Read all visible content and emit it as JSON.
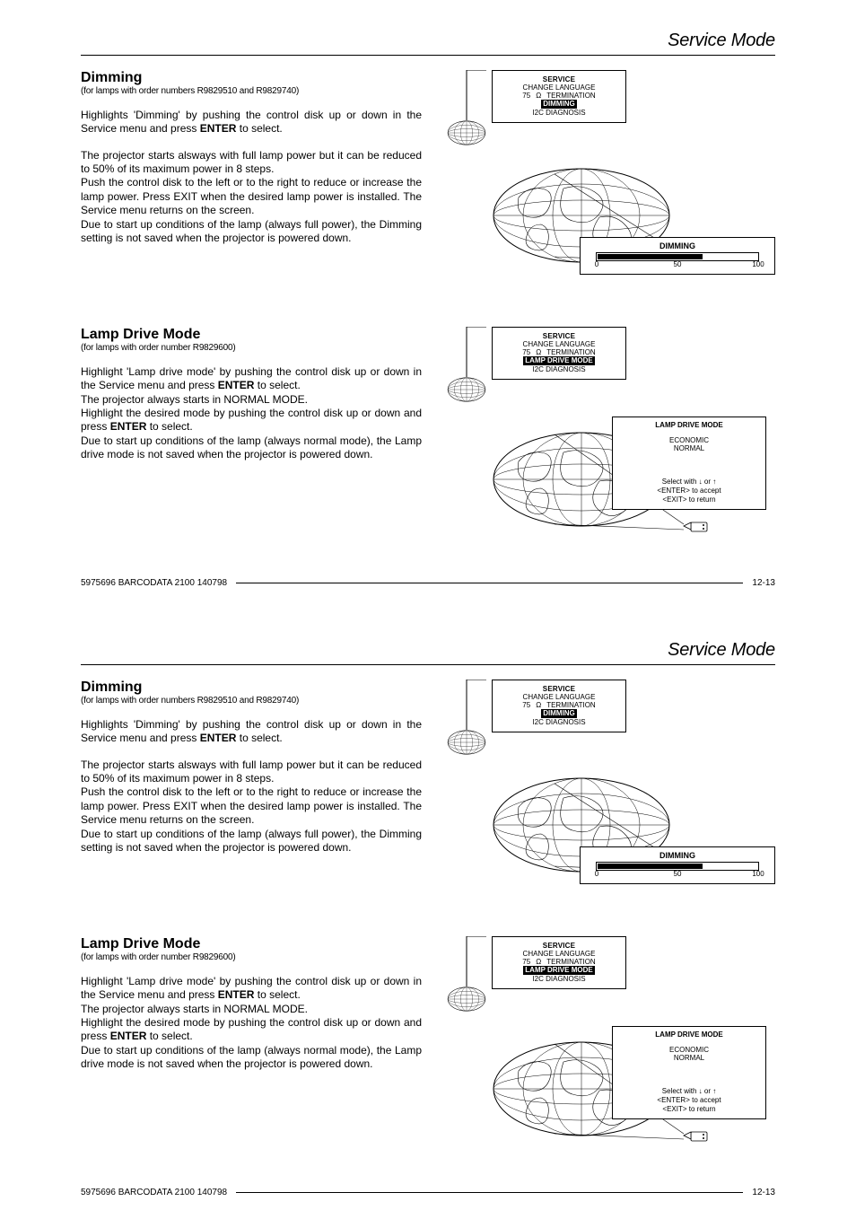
{
  "header": "Service Mode",
  "dimming": {
    "title": "Dimming",
    "sub": "(for lamps with order numbers R9829510 and R9829740)",
    "p1a": "Highlights 'Dimming' by pushing the control disk up or down in the Service menu and press ",
    "enter": "ENTER",
    "p1b": " to select.",
    "p2": "The projector starts alsways with full lamp power but it can be reduced to 50% of its maximum power in 8 steps.",
    "p3": "Push the control disk to the left or to the right to reduce or increase the lamp power.  Press EXIT when the desired lamp power is installed. The Service menu returns on the screen.",
    "p4": "Due to start up conditions of the lamp (always full power), the Dimming setting is not saved when the projector is powered down."
  },
  "ldm": {
    "title": "Lamp Drive Mode",
    "sub": "(for lamps with order number R9829600)",
    "p1a": "Highlight 'Lamp drive mode' by pushing the control disk up or down in the Service menu and press ",
    "p1b": " to select.",
    "p2": "The projector always starts in NORMAL MODE.",
    "p3a": "Highlight the desired mode by pushing the control disk up or down and press ",
    "p3b": " to select.",
    "p4": "Due to start up conditions of the lamp (always normal mode), the Lamp drive mode is not saved when the projector is powered down."
  },
  "svc": {
    "title": "SERVICE",
    "l1": "CHANGE LANGUAGE",
    "l2a": "75",
    "l2b": "TERMINATION",
    "dim": "DIMMING",
    "ldm": "LAMP DRIVE MODE",
    "diag": "I2C DIAGNOSIS"
  },
  "dimpanel": {
    "label": "DIMMING",
    "t0": "0",
    "t50": "50",
    "t100": "100"
  },
  "ldmpanel": {
    "title": "LAMP DRIVE MODE",
    "o1": "ECONOMIC",
    "o2": "NORMAL",
    "h1a": "Select with ",
    "h1b": " or ",
    "h2": "<ENTER> to accept",
    "h3": "<EXIT> to return"
  },
  "footer": {
    "left": "5975696 BARCODATA 2100 140798",
    "right": "12-13"
  }
}
